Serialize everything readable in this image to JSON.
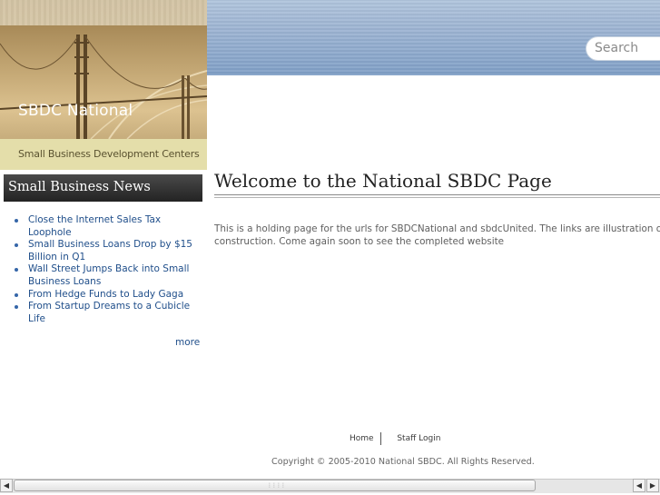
{
  "header": {
    "site_title": "SBDC National",
    "tagline": "Small Business Development Centers",
    "search_placeholder": "Search"
  },
  "sidebar": {
    "heading": "Small Business News",
    "news_items": [
      {
        "line1": "Close the Internet Sales Tax",
        "line2": "Loophole"
      },
      {
        "line1": "Small Business Loans Drop by $15",
        "line2": "Billion in Q1"
      },
      {
        "line1": "Wall Street Jumps Back into Small",
        "line2": "Business Loans"
      },
      {
        "line1": "From Hedge Funds to Lady Gaga",
        "line2": ""
      },
      {
        "line1": "From Startup Dreams to a Cubicle",
        "line2": "Life"
      }
    ],
    "more_label": "more"
  },
  "main": {
    "title": "Welcome to the National SBDC Page",
    "intro_line1": "This is a holding page for the urls for  SBDCNational and sbdcUnited. The links are illustration only. T",
    "intro_line2": "construction. Come again soon to see the completed website"
  },
  "footer": {
    "home_label": "Home",
    "staff_login_label": "Staff Login",
    "copyright": "Copyright © 2005-2010 National SBDC. All Rights Reserved."
  },
  "colors": {
    "link": "#1f4e8a",
    "header_blue": "#9cb3d2",
    "tagline_bar": "#e4deaa",
    "sidebar_heading_bg": "#2a2a2a"
  }
}
